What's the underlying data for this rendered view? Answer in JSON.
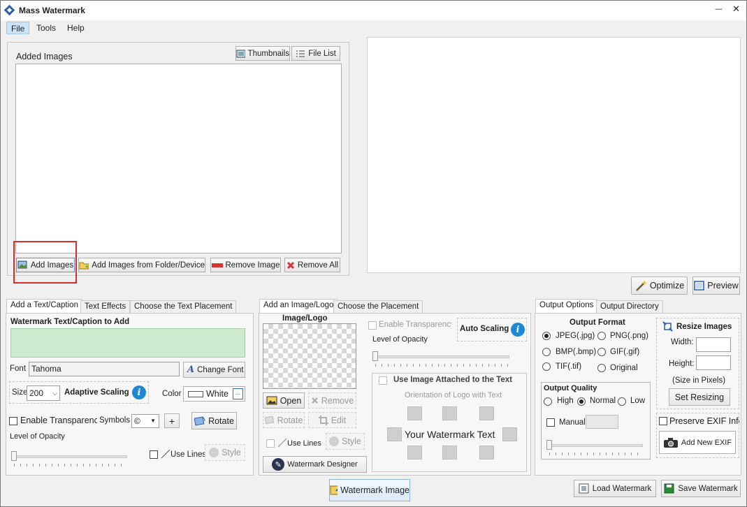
{
  "window": {
    "title": "Mass Watermark",
    "minimize_glyph": "—",
    "close_glyph": "✕"
  },
  "menu": [
    "File",
    "Tools",
    "Help"
  ],
  "added_images": {
    "title": "Added Images",
    "view_thumbnails": "Thumbnails",
    "view_filelist": "File List",
    "add_images": "Add Images",
    "add_folder": "Add Images from Folder/Device",
    "remove_image": "Remove Image",
    "remove_all": "Remove All"
  },
  "preview": {
    "optimize": "Optimize",
    "preview": "Preview"
  },
  "text_panel": {
    "tabs": [
      "Add a Text/Caption",
      "Text Effects",
      "Choose the Text Placement"
    ],
    "caption_label": "Watermark Text/Caption to Add",
    "font_label": "Font",
    "font_value": "Tahoma",
    "change_font": "Change Font",
    "size_label": "Size",
    "size_value": "200",
    "adaptive_scaling": "Adaptive Scaling",
    "color_label": "Color",
    "color_value": "White",
    "color_ellipsis": "...",
    "enable_transparency": "Enable Transparency",
    "symbols_label": "Symbols",
    "symbol_value": "©",
    "plus": "+",
    "rotate": "Rotate",
    "opacity_label": "Level of Opacity",
    "use_lines": "Use Lines",
    "style": "Style"
  },
  "image_panel": {
    "tabs": [
      "Add an Image/Logo",
      "Choose the Placement"
    ],
    "image_logo_label": "Image/Logo",
    "enable_transparency": "Enable Transparency",
    "auto_scaling": "Auto Scaling",
    "opacity_label": "Level of Opacity",
    "use_attached": "Use Image Attached to the Text",
    "orientation_label": "Orientation of Logo with Text",
    "your_text": "Your Watermark Text",
    "open": "Open",
    "remove": "Remove",
    "rotate": "Rotate",
    "edit": "Edit",
    "use_lines": "Use Lines",
    "style": "Style",
    "designer": "Watermark Designer"
  },
  "output_panel": {
    "tabs": [
      "Output Options",
      "Output Directory"
    ],
    "format_title": "Output Format",
    "formats": [
      "JPEG(.jpg)",
      "PNG(.png)",
      "BMP(.bmp)",
      "GIF(.gif)",
      "TIF(.tif)",
      "Original"
    ],
    "selected_format": "JPEG(.jpg)",
    "quality_title": "Output Quality",
    "qualities": [
      "High",
      "Normal",
      "Low"
    ],
    "selected_quality": "Normal",
    "manual": "Manual",
    "resize_title": "Resize Images",
    "width_label": "Width:",
    "height_label": "Height:",
    "size_note": "(Size in Pixels)",
    "set_resizing": "Set Resizing",
    "preserve_exif": "Preserve EXIF Info",
    "add_exif": "Add New EXIF"
  },
  "footer": {
    "watermark_image": "Watermark Image",
    "load_watermark": "Load Watermark",
    "save_watermark": "Save Watermark"
  },
  "colors": {
    "highlight": "#d92d2d",
    "caption_bg": "#cdeccf",
    "accent": "#1e88d4"
  }
}
